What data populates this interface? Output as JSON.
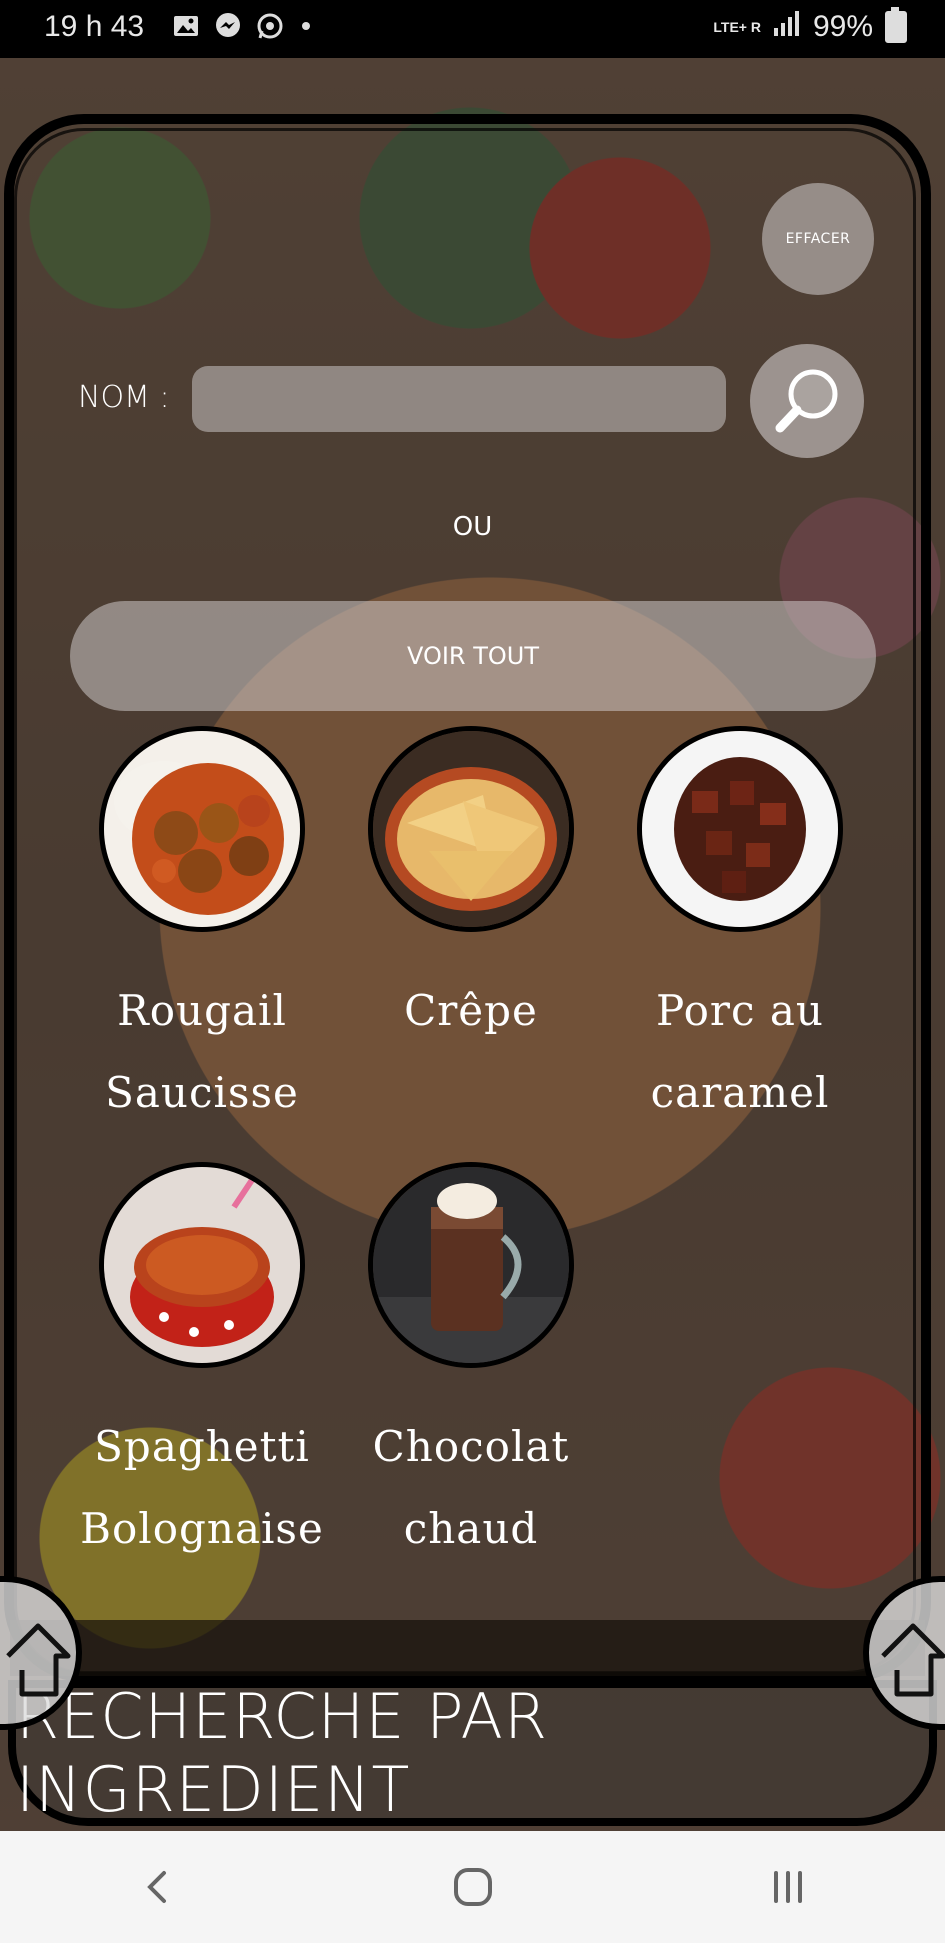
{
  "status_bar": {
    "time": "19 h 43",
    "network": "LTE+ R",
    "battery": "99%"
  },
  "search": {
    "clear_label": "EFFACER",
    "name_label": "NOM :",
    "name_value": "",
    "or_label": "OU",
    "see_all_label": "VOIR TOUT"
  },
  "recipes": [
    {
      "line1": "Rougail",
      "line2": "Saucisse",
      "image": "rougail-photo"
    },
    {
      "line1": "Crêpe",
      "line2": "",
      "image": "crepe-photo"
    },
    {
      "line1": "Porc au",
      "line2": "caramel",
      "image": "porc-caramel-photo"
    },
    {
      "line1": "Spaghetti",
      "line2": "Bolognaise",
      "image": "spaghetti-photo"
    },
    {
      "line1": "Chocolat",
      "line2": "chaud",
      "image": "chocolat-photo"
    }
  ],
  "footer": {
    "title": "RECHERCHE PAR INGREDIENT"
  },
  "icons": {
    "search": "search-icon",
    "home": "home-icon",
    "back": "back-icon",
    "home_nav": "home-nav-icon",
    "recents": "recents-icon"
  }
}
